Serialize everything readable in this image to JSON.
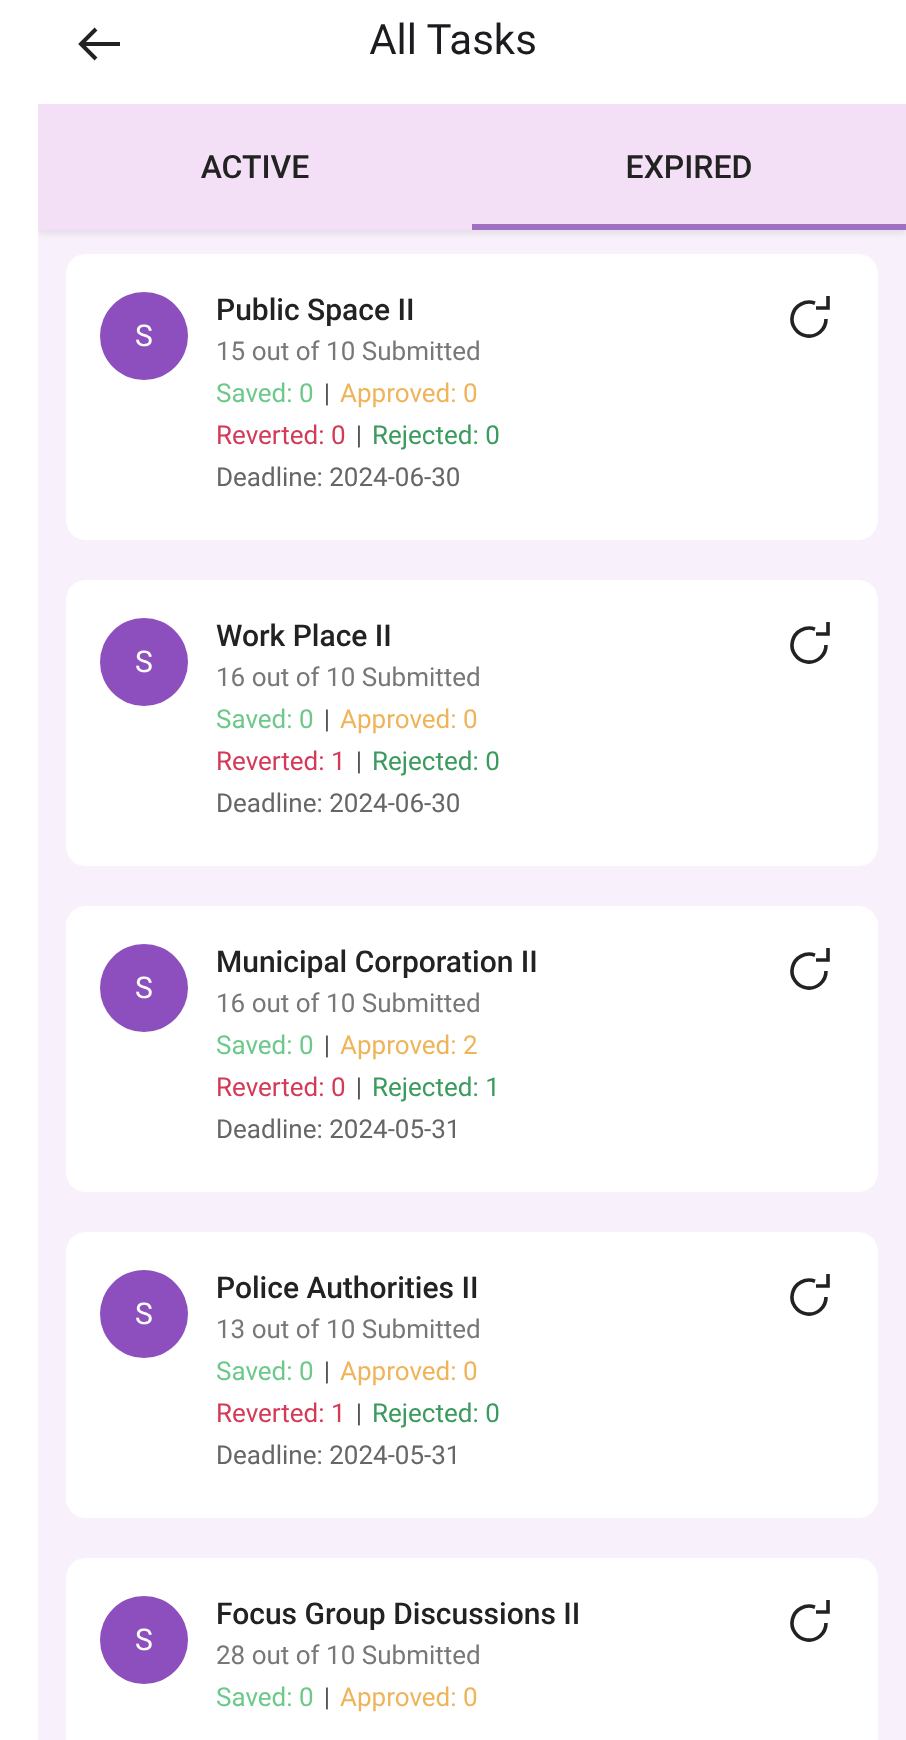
{
  "header": {
    "title": "All Tasks"
  },
  "tabs": [
    {
      "label": "ACTIVE",
      "selected": false
    },
    {
      "label": "EXPIRED",
      "selected": true
    }
  ],
  "tasks": [
    {
      "avatar": "S",
      "title": "Public Space II",
      "progress": "15 out of 10 Submitted",
      "saved": "Saved: 0",
      "approved": "Approved: 0",
      "reverted": "Reverted: 0",
      "rejected": "Rejected: 0",
      "separators": [
        "|",
        "|"
      ],
      "deadline": "Deadline: 2024-06-30"
    },
    {
      "avatar": "S",
      "title": "Work Place II",
      "progress": "16 out of 10 Submitted",
      "saved": "Saved: 0",
      "approved": "Approved: 0",
      "reverted": "Reverted: 1",
      "rejected": "Rejected: 0",
      "separators": [
        "|",
        "|"
      ],
      "deadline": "Deadline: 2024-06-30"
    },
    {
      "avatar": "S",
      "title": "Municipal Corporation II",
      "progress": "16 out of 10 Submitted",
      "saved": "Saved: 0",
      "approved": "Approved: 2",
      "reverted": "Reverted: 0",
      "rejected": "Rejected: 1",
      "separators": [
        "|",
        "|"
      ],
      "deadline": "Deadline: 2024-05-31"
    },
    {
      "avatar": "S",
      "title": "Police Authorities II",
      "progress": "13 out of 10 Submitted",
      "saved": "Saved: 0",
      "approved": "Approved: 0",
      "reverted": "Reverted: 1",
      "rejected": "Rejected: 0",
      "separators": [
        "|",
        "|"
      ],
      "deadline": "Deadline: 2024-05-31"
    },
    {
      "avatar": "S",
      "title": "Focus Group Discussions II",
      "progress": "28 out of 10 Submitted",
      "saved": "Saved: 0",
      "approved": "Approved: 0",
      "separators": [
        "|"
      ]
    }
  ]
}
